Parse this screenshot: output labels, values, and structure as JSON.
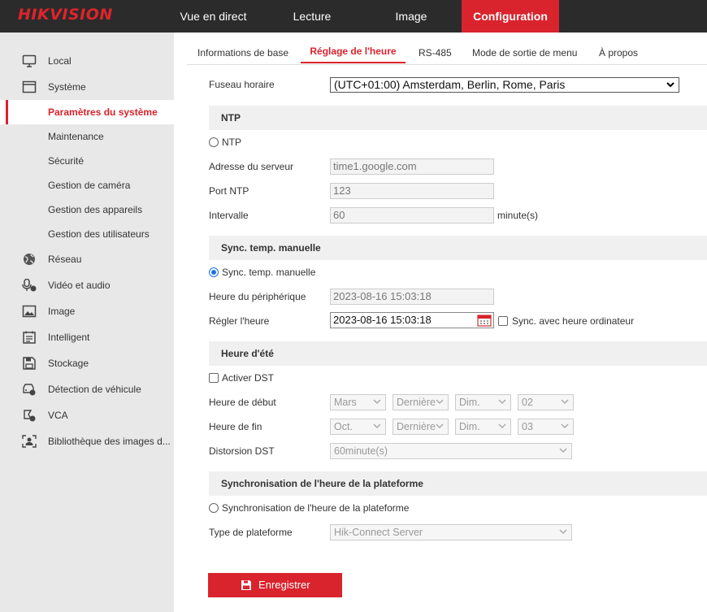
{
  "brand": {
    "logo": "HIKVISION"
  },
  "topnav": {
    "live": "Vue en direct",
    "playback": "Lecture",
    "image": "Image",
    "config": "Configuration"
  },
  "sidebar": {
    "items": [
      {
        "label": "Local",
        "icon": "monitor-icon"
      },
      {
        "label": "Système",
        "icon": "system-icon"
      },
      {
        "label": "Paramètres du système",
        "active": true
      },
      {
        "label": "Maintenance"
      },
      {
        "label": "Sécurité"
      },
      {
        "label": "Gestion de caméra"
      },
      {
        "label": "Gestion des appareils"
      },
      {
        "label": "Gestion des utilisateurs"
      },
      {
        "label": "Réseau",
        "icon": "globe-icon"
      },
      {
        "label": "Vidéo et audio",
        "icon": "mic-camera-icon"
      },
      {
        "label": "Image",
        "icon": "picture-icon"
      },
      {
        "label": "Intelligent",
        "icon": "calendar-list-icon"
      },
      {
        "label": "Stockage",
        "icon": "floppy-icon"
      },
      {
        "label": "Détection de véhicule",
        "icon": "vehicle-detect-icon"
      },
      {
        "label": "VCA",
        "icon": "vca-icon"
      },
      {
        "label": "Bibliothèque des images d...",
        "icon": "face-library-icon"
      }
    ]
  },
  "tabs": {
    "basic": "Informations de base",
    "time": "Réglage de l'heure",
    "rs485": "RS-485",
    "menu_output": "Mode de sortie de menu",
    "about": "À propos"
  },
  "form": {
    "timezone_label": "Fuseau horaire",
    "timezone_value": "(UTC+01:00) Amsterdam, Berlin, Rome, Paris",
    "ntp_section": "NTP",
    "ntp_radio": "NTP",
    "server_label": "Adresse du serveur",
    "server_value": "time1.google.com",
    "port_label": "Port NTP",
    "port_value": "123",
    "interval_label": "Intervalle",
    "interval_value": "60",
    "interval_unit": "minute(s)",
    "manual_section": "Sync. temp. manuelle",
    "manual_radio": "Sync. temp. manuelle",
    "device_time_label": "Heure du périphérique",
    "device_time_value": "2023-08-16 15:03:18",
    "set_time_label": "Régler l'heure",
    "set_time_value": "2023-08-16 15:03:18",
    "sync_pc_label": "Sync. avec heure ordinateur",
    "dst_section": "Heure d'été",
    "dst_enable": "Activer DST",
    "start_label": "Heure de début",
    "start_month": "Mars",
    "start_week": "Dernière",
    "start_day": "Dim.",
    "start_hour": "02",
    "end_label": "Heure de fin",
    "end_month": "Oct.",
    "end_week": "Dernière",
    "end_day": "Dim.",
    "end_hour": "03",
    "bias_label": "Distorsion DST",
    "bias_value": "60minute(s)",
    "platform_section": "Synchronisation de l'heure de la plateforme",
    "platform_radio": "Synchronisation de l'heure de la plateforme",
    "platform_type_label": "Type de plateforme",
    "platform_type_value": "Hik-Connect Server"
  },
  "save_label": "Enregistrer",
  "colors": {
    "accent": "#d9232d",
    "topbar": "#2b2b2b",
    "sidebar": "#e8e8e8",
    "radio": "#1a73e8"
  }
}
